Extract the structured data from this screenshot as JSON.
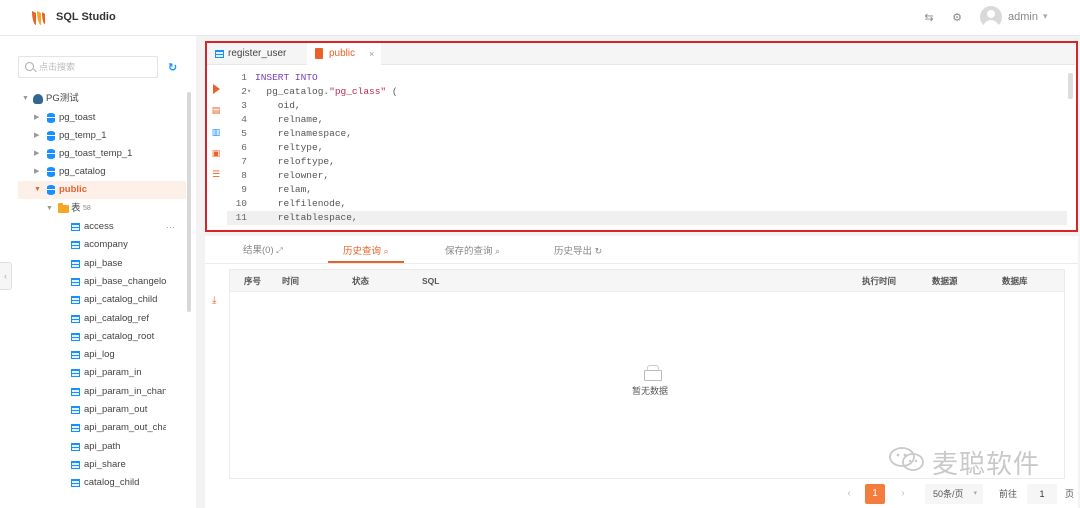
{
  "app": {
    "title": "SQL Studio",
    "user": "admin"
  },
  "sidebar": {
    "search_placeholder": "点击搜索",
    "tree": {
      "root": "PG测试",
      "schemas": [
        "pg_toast",
        "pg_temp_1",
        "pg_toast_temp_1",
        "pg_catalog",
        "public"
      ],
      "table_folder": "表",
      "table_count": "58",
      "tables": [
        "access",
        "acompany",
        "api_base",
        "api_base_changelo",
        "api_catalog_child",
        "api_catalog_ref",
        "api_catalog_root",
        "api_log",
        "api_param_in",
        "api_param_in_chan",
        "api_param_out",
        "api_param_out_cha",
        "api_path",
        "api_share",
        "catalog_child"
      ]
    }
  },
  "editor": {
    "tabs": [
      {
        "label": "register_user"
      },
      {
        "label": "public",
        "close": "×"
      }
    ],
    "lines": [
      {
        "n": "1",
        "kw": "INSERT INTO",
        "text": ""
      },
      {
        "n": "2",
        "fold": "▾",
        "text": "  pg_catalog.",
        "str": "\"pg_class\"",
        "tail": " ("
      },
      {
        "n": "3",
        "text": "    oid,"
      },
      {
        "n": "4",
        "text": "    relname,"
      },
      {
        "n": "5",
        "text": "    relnamespace,"
      },
      {
        "n": "6",
        "text": "    reltype,"
      },
      {
        "n": "7",
        "text": "    reloftype,"
      },
      {
        "n": "8",
        "text": "    relowner,"
      },
      {
        "n": "9",
        "text": "    relam,"
      },
      {
        "n": "10",
        "text": "    relfilenode,"
      },
      {
        "n": "11",
        "text": "    reltablespace,"
      }
    ]
  },
  "results": {
    "tabs": [
      "结果(0)",
      "历史查询",
      "保存的查询",
      "历史导出"
    ],
    "columns": [
      "序号",
      "时间",
      "状态",
      "SQL",
      "执行时间",
      "数据源",
      "数据库"
    ],
    "empty_text": "暂无数据",
    "pagination": {
      "current_page": "1",
      "page_size": "50条/页",
      "goto_label": "前往",
      "goto_value": "1",
      "page_suffix": "页"
    }
  },
  "watermark": {
    "text": "麦聪软件"
  },
  "colors": {
    "accent": "#e8622a",
    "highlight_border": "#d9232b",
    "link_blue": "#1890ff"
  }
}
